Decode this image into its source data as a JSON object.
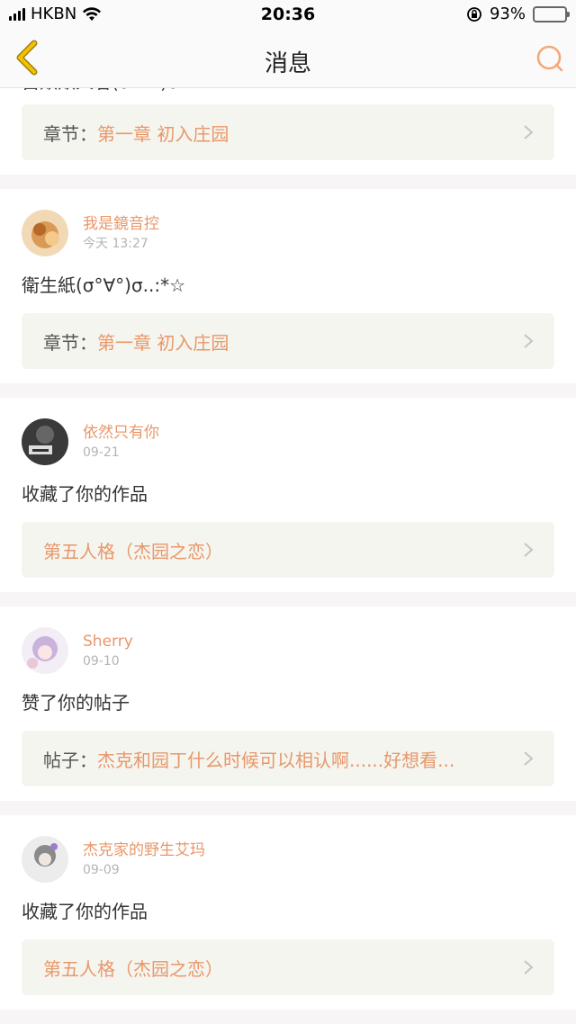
{
  "status": {
    "carrier": "HKBN",
    "time": "20:36",
    "battery": "93%",
    "battery_level": 0.93
  },
  "header": {
    "title": "消息"
  },
  "colors": {
    "accent": "#e8976a",
    "battery_green": "#4cd964",
    "back_arrow": "#f2c200"
  },
  "cards": [
    {
      "content": "自欺欺人者(σ°∀°)σ..:*☆",
      "ref_label": "章节：",
      "ref_value": "第一章 初入庄园"
    },
    {
      "name": "我是鏡音控",
      "date": "今天 13:27",
      "content": "衛生紙(σ°∀°)σ..:*☆",
      "ref_label": "章节：",
      "ref_value": "第一章 初入庄园"
    },
    {
      "name": "依然只有你",
      "date": "09-21",
      "content": "收藏了你的作品",
      "ref_value": "第五人格（杰园之恋）"
    },
    {
      "name": "Sherry",
      "date": "09-10",
      "content": "赞了你的帖子",
      "ref_label": "帖子：",
      "ref_value": "杰克和园丁什么时候可以相认啊......好想看..."
    },
    {
      "name": "杰克家的野生艾玛",
      "date": "09-09",
      "content": "收藏了你的作品",
      "ref_value": "第五人格（杰园之恋）"
    }
  ]
}
